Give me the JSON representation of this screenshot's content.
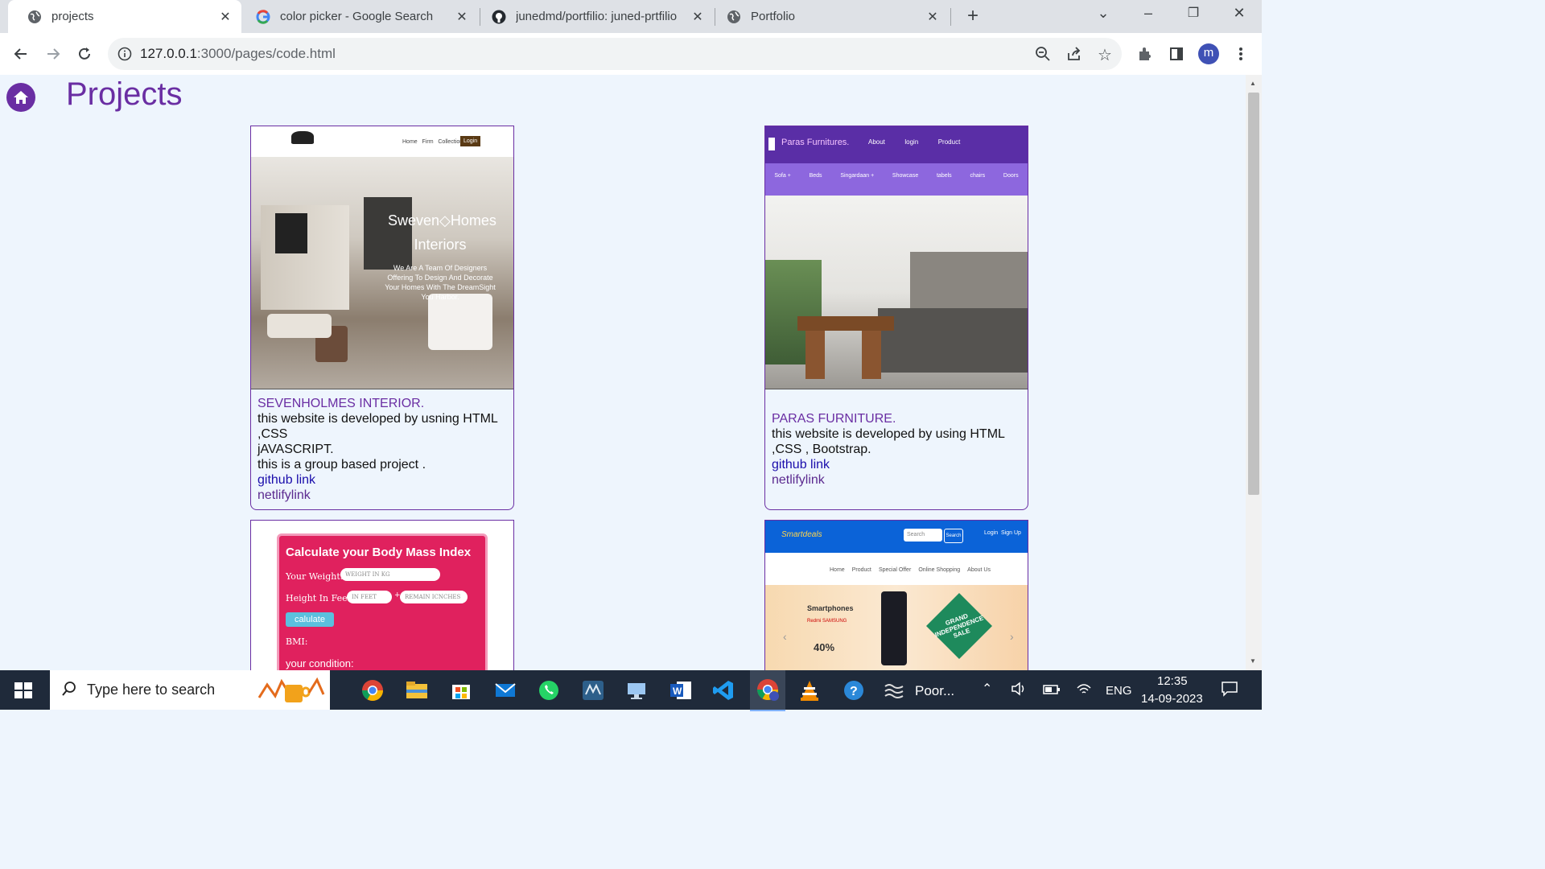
{
  "browser": {
    "tabs": [
      {
        "title": "projects",
        "icon": "globe-icon",
        "active": true
      },
      {
        "title": "color picker - Google Search",
        "icon": "google-icon",
        "active": false
      },
      {
        "title": "junedmd/portfilio: juned-prtfilio",
        "icon": "github-icon",
        "active": false
      },
      {
        "title": "Portfolio",
        "icon": "globe-icon",
        "active": false
      }
    ],
    "url_host": "127.0.0.1",
    "url_path": ":3000/pages/code.html",
    "profile_initial": "m"
  },
  "page": {
    "heading": "Projects",
    "projects": [
      {
        "name": "SEVENHOLMES INTERIOR.",
        "desc_lines": [
          "this website is developed by usning HTML ,CSS",
          "jAVASCRIPT.",
          "this is a group based project ."
        ],
        "github_label": "github link",
        "netlify_label": "netlifylink",
        "shot": {
          "brand": "Sweven Homes Interiors",
          "headline_1": "Sweven◇Homes",
          "headline_2": "Interiors",
          "tagline": "We Are A Team Of Designers Offering To Design And Decorate Your Homes With The DreamSight You Harbor.",
          "nav": [
            "Home",
            "Firm",
            "Collections"
          ],
          "login": "Login"
        }
      },
      {
        "name": "PARAS FURNITURE.",
        "desc_lines": [
          "this website is developed by using HTML ,CSS , Bootstrap."
        ],
        "github_label": "github link",
        "netlify_label": "netlifylink",
        "shot": {
          "brand": "Paras Furnitures.",
          "nav": [
            "About",
            "login",
            "Product"
          ],
          "categories": [
            "Sofa +",
            "Beds",
            "Singardaan +",
            "Showcase",
            "tabels",
            "chairs",
            "Doors"
          ]
        }
      },
      {
        "shot": {
          "title": "Calculate your Body Mass Index",
          "weight_label": "Your Weight:",
          "weight_ph": "WEIGHT IN KG",
          "height_label": "Height In Feet:",
          "feet_ph": "IN FEET",
          "inch_ph": "REMAIN ICNCHES",
          "plus": "+",
          "button": "calulate",
          "bmi_label": "BMI:",
          "condition_label": "your condition:"
        }
      },
      {
        "shot": {
          "brand": "Smartdeals",
          "search_ph": "Search",
          "search_btn": "Search",
          "nav": [
            "Login",
            "Sign Up"
          ],
          "menu": [
            "Home",
            "Product",
            "Special Offer",
            "Online Shopping",
            "About Us"
          ],
          "banner_title": "Smartphones",
          "banner_brands": "Redmi  SAMSUNG",
          "banner_offer": "40%",
          "sale_text": "GRAND INDEPENDENCE SALE"
        }
      }
    ]
  },
  "taskbar": {
    "search_placeholder": "Type here to search",
    "weather": "Poor...",
    "lang": "ENG",
    "time": "12:35",
    "date": "14-09-2023"
  }
}
